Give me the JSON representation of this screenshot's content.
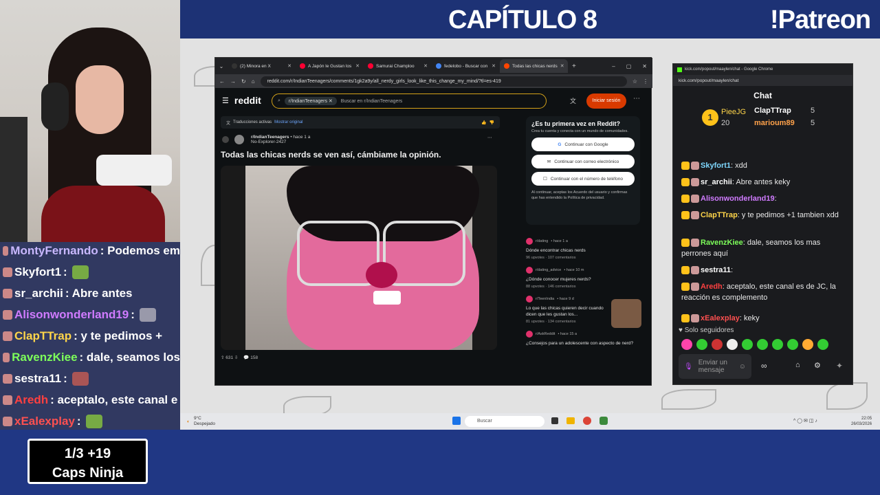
{
  "overlay": {
    "chapter": "CAPÍTULO 8",
    "patreon": "!Patreon",
    "counter_line1": "1/3  +19",
    "counter_line2": "Caps Ninja"
  },
  "stream_chat": [
    {
      "user": "MontyFernando",
      "text": ": Podemos em",
      "color": "#c9b8ff"
    },
    {
      "user": "Skyfort1",
      "text": " :",
      "color": "#ffffff"
    },
    {
      "user": "sr_archii",
      "text": " : Abre antes",
      "color": "#ffffff"
    },
    {
      "user": "Alisonwonderland19",
      "text": " :",
      "color": "#d07bff"
    },
    {
      "user": "ClapTTrap",
      "text": " : y te pedimos +",
      "color": "#ffd54a"
    },
    {
      "user": "RavenzKiee",
      "text": " : dale, seamos los",
      "color": "#7dff5a"
    },
    {
      "user": "sestra11",
      "text": " :",
      "color": "#ffffff"
    },
    {
      "user": "Aredh",
      "text": " : aceptalo, este canal e",
      "color": "#ff4040"
    },
    {
      "user": "xEalexplay",
      "text": " :",
      "color": "#ff5050"
    }
  ],
  "browser": {
    "tabs": [
      {
        "label": "(2) Minora en X",
        "color": "#333333"
      },
      {
        "label": "A Japón le Gustan los",
        "color": "#ff0033"
      },
      {
        "label": "Samurai Champloo",
        "color": "#ff0033"
      },
      {
        "label": "fedelobo - Buscar con",
        "color": "#4285f4"
      },
      {
        "label": "Todas las chicas nerds",
        "color": "#ff4500"
      }
    ],
    "url": "reddit.com/r/IndianTeenagers/comments/1gk2a9y/all_nerdy_girls_look_like_this_change_my_mind/?tl=es-419",
    "logo": "reddit",
    "search_chip": "r/IndianTeenagers",
    "search_placeholder": "Buscar en r/IndianTeenagers",
    "login": "Iniciar sesión"
  },
  "post": {
    "translation": "Traducciones activas",
    "show_original": "Mostrar original",
    "subreddit": "r/IndianTeenagers",
    "time": "• hace 1 a",
    "author": "No-Explorer-2427",
    "title": "Todas las chicas nerds se ven así, cámbiame la opinión.",
    "votes": "631",
    "comments": "158"
  },
  "sidebar": {
    "first_title": "¿Es tu primera vez en Reddit?",
    "first_sub": "Crea tu cuenta y conecta con un mundo de comunidades.",
    "google": "Continuar con Google",
    "email": "Continuar con correo electrónico",
    "phone": "Continuar con el número de teléfono",
    "terms": "Al continuar, aceptas los Acuerdo del usuario y confirmas que has entendido la Política de privacidad.",
    "related": [
      {
        "sub": "r/dating",
        "time": "• hace 1 a",
        "title": "Dónde encontrar chicas nerds",
        "stats": "96 upvotes · 107 comentarios"
      },
      {
        "sub": "r/dating_advice",
        "time": "• hace 10 m",
        "title": "¿Dónde conocer mujeres nerds?",
        "stats": "88 upvotes · 146 comentarios"
      },
      {
        "sub": "r/TeenIndia",
        "time": "• hace 9 d",
        "title": "Lo que las chicas quieren decir cuando dicen que les gustan los...",
        "stats": "81 upvotes · 134 comentarios"
      },
      {
        "sub": "r/AskReddit",
        "time": "• hace 15 a",
        "title": "¿Consejos para un adolescente con aspecto de nerd?",
        "stats": ""
      }
    ]
  },
  "chat": {
    "window_title": "kick.com/popout/maaylen/chat - Google Chrome",
    "url": "kick.com/popout/maaylen/chat",
    "title": "Chat",
    "leader1_name": "PieeJG",
    "leader1_count": "20",
    "leader2_name": "ClapTTrap",
    "leader2_count": "5",
    "leader3_name": "marioum89",
    "leader3_count": "5",
    "messages": [
      {
        "user": "Skyfort1",
        "text": ": xdd",
        "color": "#7fd8ff"
      },
      {
        "user": "sr_archii",
        "text": ": Abre antes keky",
        "color": "#ffffff"
      },
      {
        "user": "Alisonwonderland19",
        "text": ":",
        "color": "#d07bff"
      },
      {
        "user": "ClapTTrap",
        "text": ": y te pedimos +1 tambien xdd",
        "color": "#ffd54a"
      },
      {
        "user": "RavenzKiee",
        "text": ": dale, seamos los mas perrones aquí",
        "color": "#7dff5a"
      },
      {
        "user": "sestra11",
        "text": ":",
        "color": "#ffffff"
      },
      {
        "user": "Aredh",
        "text": ": aceptalo, este canal es de JC, la reacción es complemento",
        "color": "#ff4040"
      },
      {
        "user": "xEalexplay",
        "text": ": keky",
        "color": "#ff5050"
      }
    ],
    "followers_only": "Solo seguidores",
    "input_placeholder": "Enviar un mensaje"
  },
  "taskbar": {
    "weather_temp": "9°C",
    "weather_desc": "Despejado",
    "search": "Buscar",
    "time": "22:05",
    "date": "26/03/2026"
  }
}
